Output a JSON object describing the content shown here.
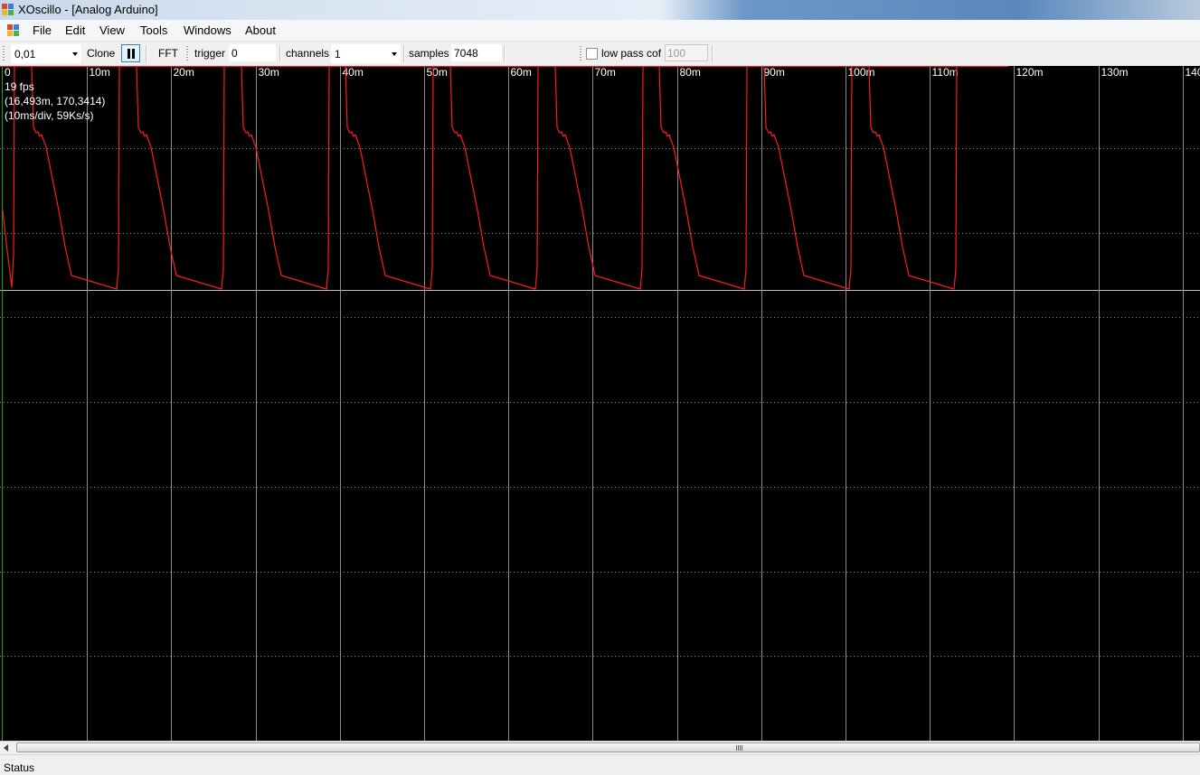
{
  "window": {
    "title": "XOscillo - [Analog Arduino]"
  },
  "menu": {
    "items": [
      "File",
      "Edit",
      "View",
      "Tools",
      "Windows",
      "About"
    ]
  },
  "toolbar": {
    "timebase_value": "0,01",
    "clone_label": "Clone",
    "fft_label": "FFT",
    "trigger_label": "trigger",
    "trigger_value": "0",
    "channels_label": "channels",
    "channels_value": "1",
    "samples_label": "samples",
    "samples_value": "7048",
    "lowpass_label": "low pass cof",
    "lowpass_value": "100",
    "lowpass_checked": false,
    "pause_icon": "pause-icon"
  },
  "scope": {
    "x_tick_labels": [
      "0",
      "10m",
      "20m",
      "30m",
      "40m",
      "50m",
      "60m",
      "70m",
      "80m",
      "90m",
      "100m",
      "110m",
      "120m",
      "130m",
      "140"
    ],
    "fps": "19 fps",
    "cursor_readout": "(16,493m, 170,3414)",
    "timebase_readout": "(10ms/div, 59Ks/s)",
    "trace_color": "#ff1a1a",
    "grid_color": "#8c8c8c",
    "background": "#000000"
  },
  "status": {
    "text": "Status"
  }
}
